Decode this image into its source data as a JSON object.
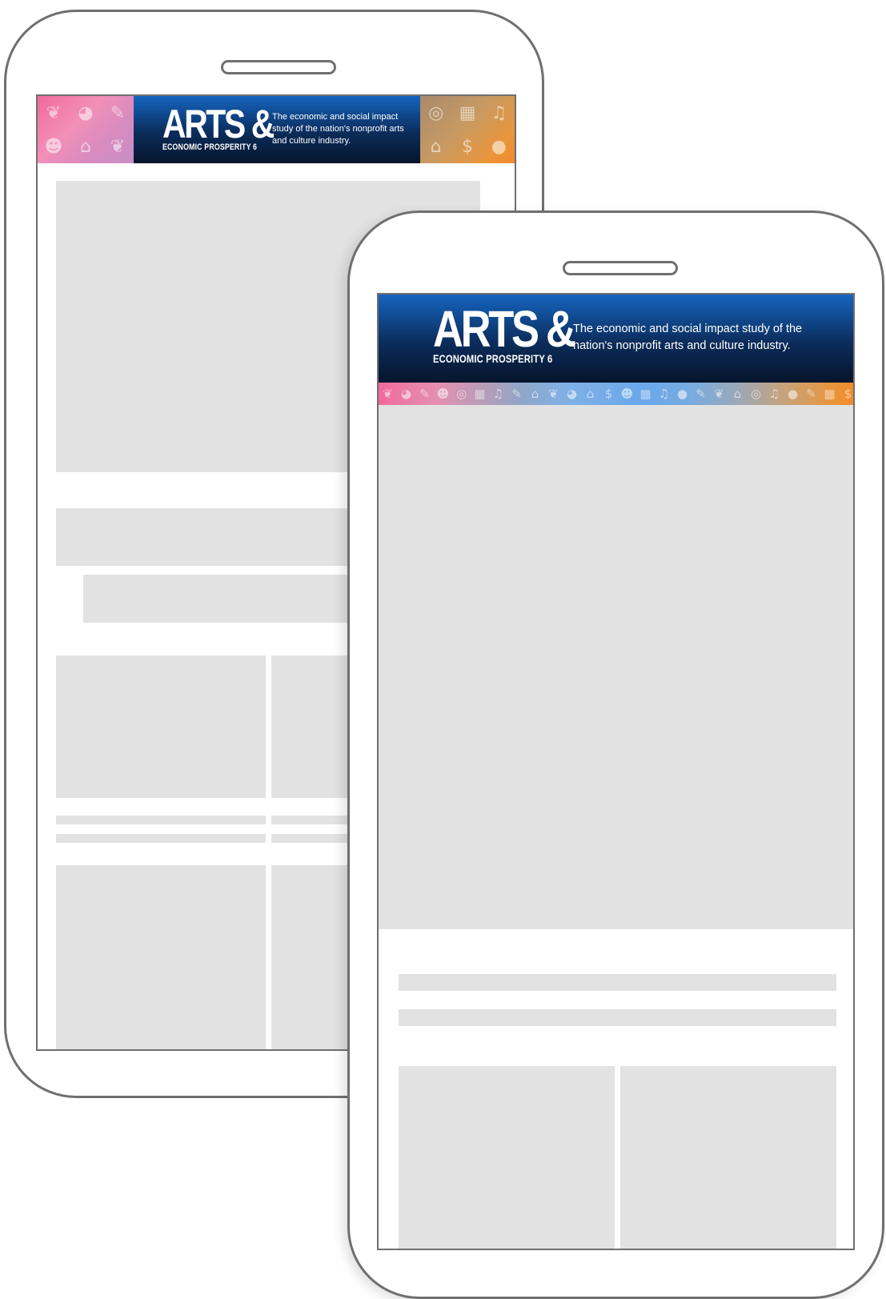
{
  "desktop_banner": {
    "logo_main": "ARTS &",
    "logo_sub": "ECONOMIC PROSPERITY 6",
    "tagline": "The economic and social impact study of the nation's nonprofit arts and culture industry.",
    "left_tiles": [
      "leaf-icon",
      "palette-icon",
      "brush-icon",
      "mask-icon",
      "house-icon",
      "leaf-icon"
    ],
    "right_tiles": [
      "camera-icon",
      "building-icon",
      "music-icon",
      "house-icon",
      "dollar-icon",
      "person-icon"
    ]
  },
  "mobile_banner": {
    "logo_main": "ARTS &",
    "logo_sub": "ECONOMIC PROSPERITY 6",
    "tagline": "The economic and social impact study of the nation's nonprofit arts and culture industry."
  },
  "colors": {
    "banner_blue": "#1565c0",
    "banner_navy": "#06152c",
    "pink": "#f06a9b",
    "light_blue": "#6aa8ea",
    "orange": "#f28a2a",
    "placeholder": "#e2e2e2",
    "device_outline": "#6f6f6f"
  }
}
